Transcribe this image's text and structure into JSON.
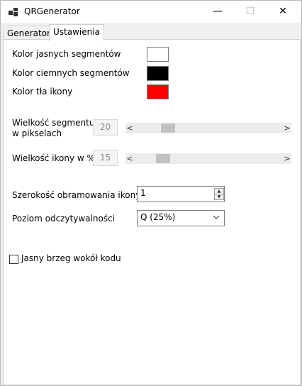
{
  "window": {
    "title": "QRGenerator",
    "minimize_glyph": "—",
    "maximize_glyph": "☐",
    "close_glyph": "✕"
  },
  "tabs": [
    {
      "label": "Generator"
    },
    {
      "label": "Ustawienia"
    }
  ],
  "settings": {
    "light_color_label": "Kolor jasnych segmentów",
    "light_color": "#ffffff",
    "dark_color_label": "Kolor ciemnych segmentów",
    "dark_color": "#000000",
    "icon_bg_label": "Kolor tła ikony",
    "icon_bg_color": "#ff0000",
    "segment_size_label_line1": "Wielkość segmentu",
    "segment_size_label_line2": "w pikselach",
    "segment_size_value": "20",
    "icon_size_label": "Wielkość ikony w %",
    "icon_size_value": "15",
    "border_width_label": "Szerokość obramowania ikony",
    "border_width_value": "1",
    "readability_label": "Poziom odczytywalności",
    "readability_value": "Q (25%)",
    "quiet_zone_label": "Jasny brzeg wokół kodu",
    "quiet_zone_checked": false
  }
}
